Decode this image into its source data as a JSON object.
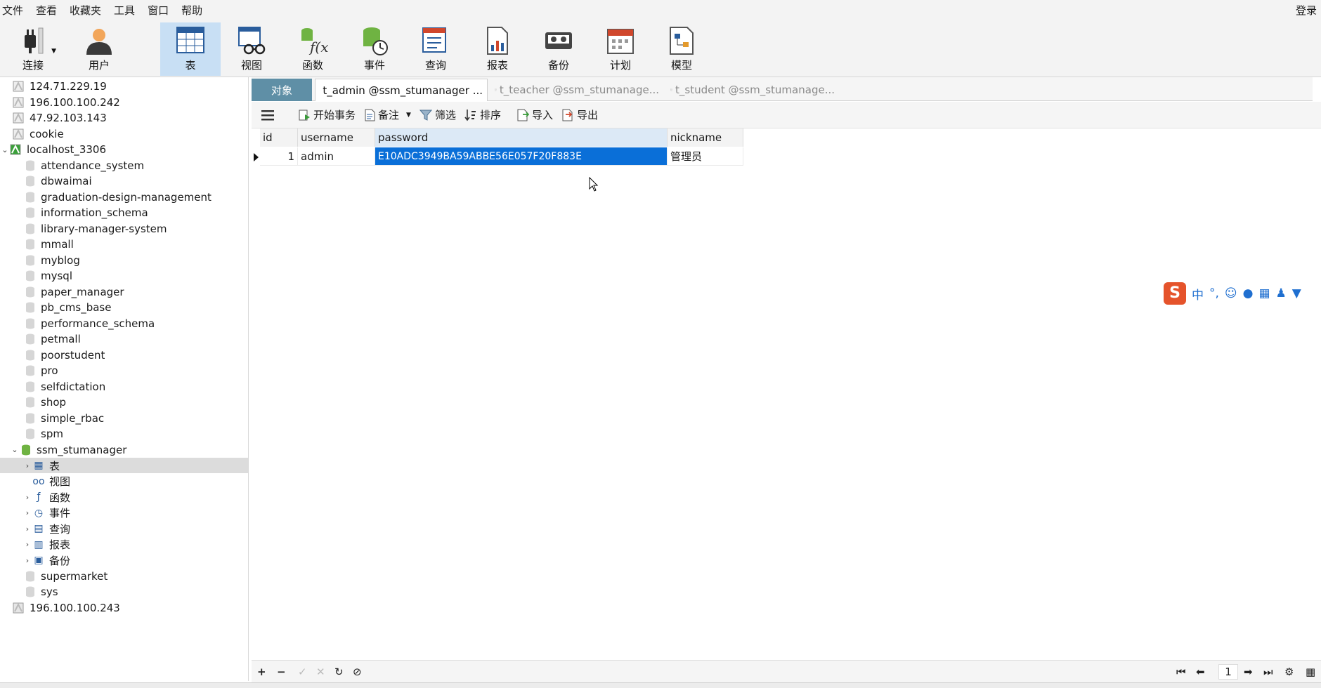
{
  "menu": {
    "items": [
      "文件",
      "查看",
      "收藏夹",
      "工具",
      "窗口",
      "帮助"
    ],
    "login": "登录"
  },
  "toolbar": {
    "buttons": [
      {
        "label": "连接",
        "icon": "plug-icon"
      },
      {
        "label": "用户",
        "icon": "user-icon"
      },
      {
        "label": "表",
        "icon": "table-icon"
      },
      {
        "label": "视图",
        "icon": "view-icon"
      },
      {
        "label": "函数",
        "icon": "function-icon"
      },
      {
        "label": "事件",
        "icon": "event-icon"
      },
      {
        "label": "查询",
        "icon": "query-icon"
      },
      {
        "label": "报表",
        "icon": "report-icon"
      },
      {
        "label": "备份",
        "icon": "backup-icon"
      },
      {
        "label": "计划",
        "icon": "schedule-icon"
      },
      {
        "label": "模型",
        "icon": "model-icon"
      }
    ],
    "active": "表"
  },
  "tree": {
    "connections_top": [
      "124.71.229.19",
      "196.100.100.242",
      "47.92.103.143",
      "cookie"
    ],
    "open_connection": "localhost_3306",
    "databases": [
      "attendance_system",
      "dbwaimai",
      "graduation-design-management",
      "information_schema",
      "library-manager-system",
      "mmall",
      "myblog",
      "mysql",
      "paper_manager",
      "pb_cms_base",
      "performance_schema",
      "petmall",
      "poorstudent",
      "pro",
      "selfdictation",
      "shop",
      "simple_rbac",
      "spm"
    ],
    "open_database": "ssm_stumanager",
    "children": [
      "表",
      "视图",
      "函数",
      "事件",
      "查询",
      "报表",
      "备份"
    ],
    "databases_after": [
      "supermarket",
      "sys"
    ],
    "connection_bottom": "196.100.100.243"
  },
  "tabs": {
    "objects": "对象",
    "items": [
      "t_admin @ssm_stumanager ...",
      "t_teacher @ssm_stumanage...",
      "t_student @ssm_stumanage..."
    ]
  },
  "subbar": {
    "begin_tx": "开始事务",
    "note": "备注",
    "filter": "筛选",
    "sort": "排序",
    "import": "导入",
    "export": "导出"
  },
  "grid": {
    "columns": [
      "id",
      "username",
      "password",
      "nickname"
    ],
    "rows": [
      {
        "id": "1",
        "username": "admin",
        "password": "E10ADC3949BA59ABBE56E057F20F883E",
        "nickname": "管理员"
      }
    ]
  },
  "pager": {
    "page": "1"
  },
  "ime": {
    "mode": "中"
  },
  "colors": {
    "tab_objects": "#5f8fa6",
    "selected_cell": "#0a6fd8",
    "toolbar_active": "#c8dff4"
  }
}
